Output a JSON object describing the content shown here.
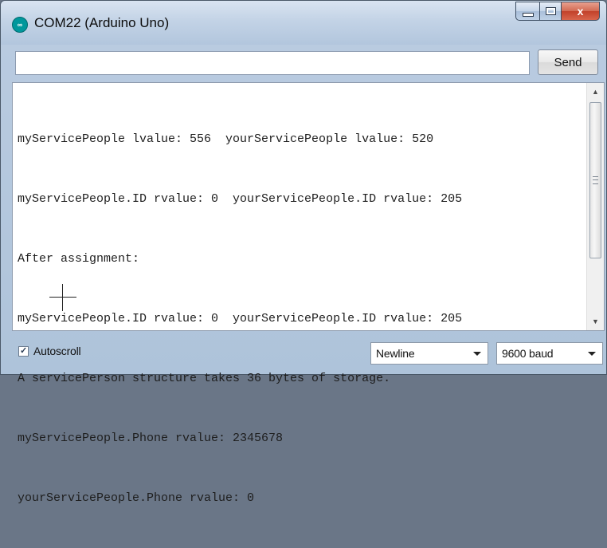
{
  "window": {
    "title": "COM22 (Arduino Uno)",
    "icon": "arduino-logo-icon",
    "app_icon_glyph": "∞",
    "close_glyph": "x"
  },
  "input": {
    "value": "",
    "send_label": "Send"
  },
  "console": {
    "lines": [
      "myServicePeople lvalue: 556  yourServicePeople lvalue: 520",
      "myServicePeople.ID rvalue: 0  yourServicePeople.ID rvalue: 205",
      "After assignment:",
      "myServicePeople.ID rvalue: 0  yourServicePeople.ID rvalue: 205",
      "A servicePerson structure takes 36 bytes of storage.",
      "myServicePeople.Phone rvalue: 2345678",
      "yourServicePeople.Phone rvalue: 0"
    ]
  },
  "footer": {
    "autoscroll_label": "Autoscroll",
    "autoscroll_checked": true,
    "check_glyph": "✓",
    "line_ending": "Newline",
    "baud_rate": "9600 baud"
  },
  "colors": {
    "arduino_teal": "#00979c",
    "close_red": "#c2412a"
  }
}
